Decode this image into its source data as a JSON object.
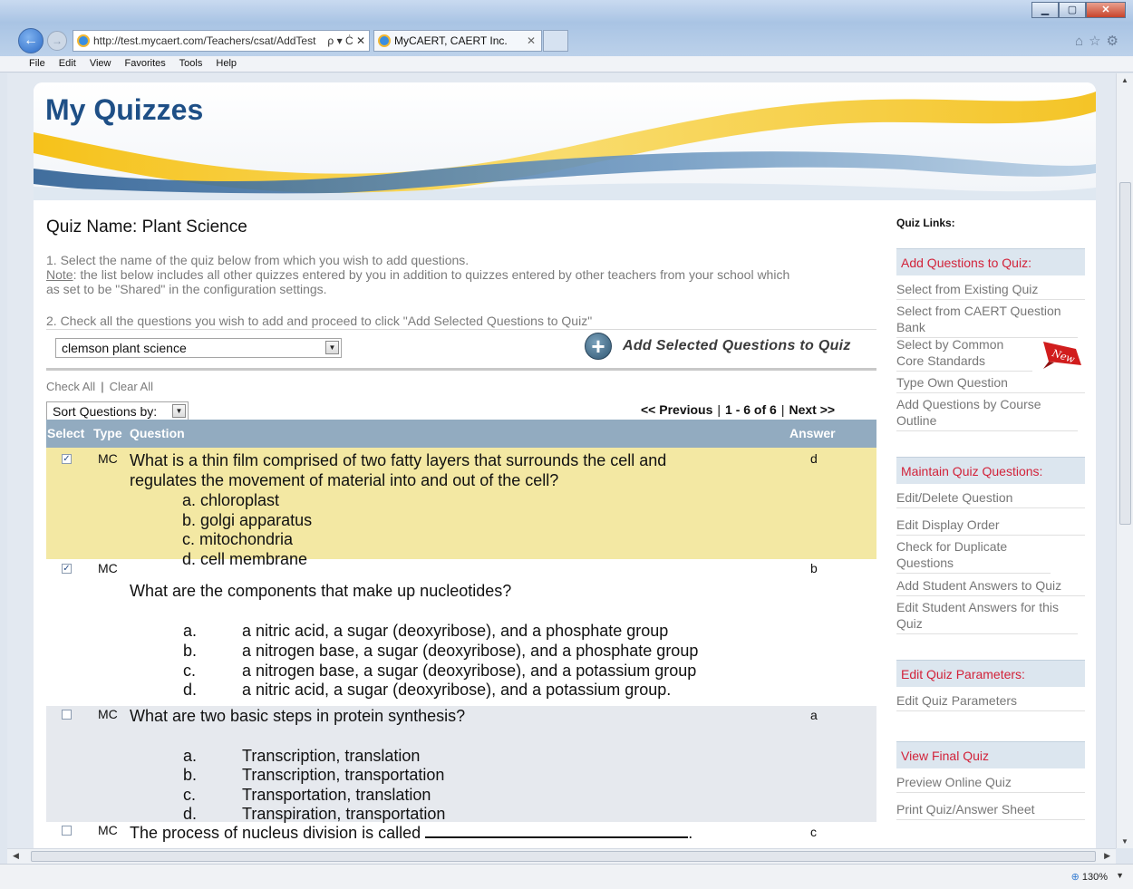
{
  "browser": {
    "address": "http://test.mycaert.com/Teachers/csat/AddTest",
    "address_tools": "ρ ▾ Ċ ✕",
    "tab_title": "MyCAERT, CAERT Inc.",
    "menu": [
      "File",
      "Edit",
      "View",
      "Favorites",
      "Tools",
      "Help"
    ],
    "zoom": "130%"
  },
  "page": {
    "title": "My Quizzes",
    "quiz_name": "Quiz Name: Plant Science",
    "step1": "1. Select the name of the quiz below from which you wish to add questions.",
    "note_label": "Note",
    "note_text": ": the list below includes all other quizzes entered by you in addition to quizzes entered by other teachers from your school which",
    "note_text2": "as set to be \"Shared\" in the configuration settings.",
    "step2": "2. Check all the questions you wish to add and proceed to click \"Add Selected Questions to Quiz\"",
    "quiz_select": "clemson plant science",
    "add_button": "Add Selected Questions to Quiz",
    "check_all": "Check All",
    "clear_all": "Clear All",
    "sort_label": "Sort Questions by:",
    "pager": {
      "prev": "<< Previous",
      "range": "1 - 6 of 6",
      "next": "Next >>"
    },
    "columns": {
      "select": "Select",
      "type": "Type",
      "question": "Question",
      "answer": "Answer"
    }
  },
  "questions": [
    {
      "checked": true,
      "type": "MC",
      "answer": "d",
      "text1": "What is a thin film comprised of two fatty layers that surrounds the cell and",
      "text2": "regulates the movement of material into and out of the cell?",
      "options": [
        "a. chloroplast",
        "b. golgi apparatus",
        "c. mitochondria",
        "d. cell membrane"
      ]
    },
    {
      "checked": true,
      "type": "MC",
      "answer": "b",
      "text1": "What are the components that make up nucleotides?",
      "letters": [
        "a.",
        "b.",
        "c.",
        "d."
      ],
      "options": [
        "a nitric acid, a sugar (deoxyribose), and a phosphate group",
        "a nitrogen base, a sugar (deoxyribose), and a phosphate group",
        "a nitrogen base, a sugar (deoxyribose), and a potassium group",
        "a nitric acid, a sugar (deoxyribose), and a potassium group."
      ]
    },
    {
      "checked": false,
      "type": "MC",
      "answer": "a",
      "text1": "What are two basic steps in protein synthesis?",
      "letters": [
        "a.",
        "b.",
        "c.",
        "d."
      ],
      "options": [
        "Transcription, translation",
        "Transcription, transportation",
        "Transportation, translation",
        "Transpiration, transportation"
      ]
    },
    {
      "checked": false,
      "type": "MC",
      "answer": "c",
      "text1": "The process of nucleus division is called",
      "text_end": "."
    }
  ],
  "sidebar": {
    "title": "Quiz Links:",
    "sections": [
      {
        "heading": "Add Questions to Quiz:",
        "links": [
          "Select from Existing Quiz",
          "Select from CAERT Question Bank",
          "Select by Common Core Standards",
          "Type Own Question",
          "Add Questions by Course Outline"
        ]
      },
      {
        "heading": "Maintain Quiz Questions:",
        "links": [
          "Edit/Delete Question",
          "Edit Display Order",
          "Check for Duplicate Questions",
          "Add Student Answers to Quiz",
          "Edit Student Answers for this Quiz"
        ]
      },
      {
        "heading": "Edit Quiz Parameters:",
        "links": [
          "Edit Quiz Parameters"
        ]
      },
      {
        "heading": "View Final Quiz",
        "links": [
          "Preview Online Quiz",
          "Print Quiz/Answer Sheet"
        ]
      }
    ],
    "new_badge": "New"
  },
  "colors": {
    "title_blue": "#1e4f86",
    "header_bar": "#92abc0",
    "highlight_row": "#f3e8a3",
    "side_heading_text": "#d2233a"
  }
}
